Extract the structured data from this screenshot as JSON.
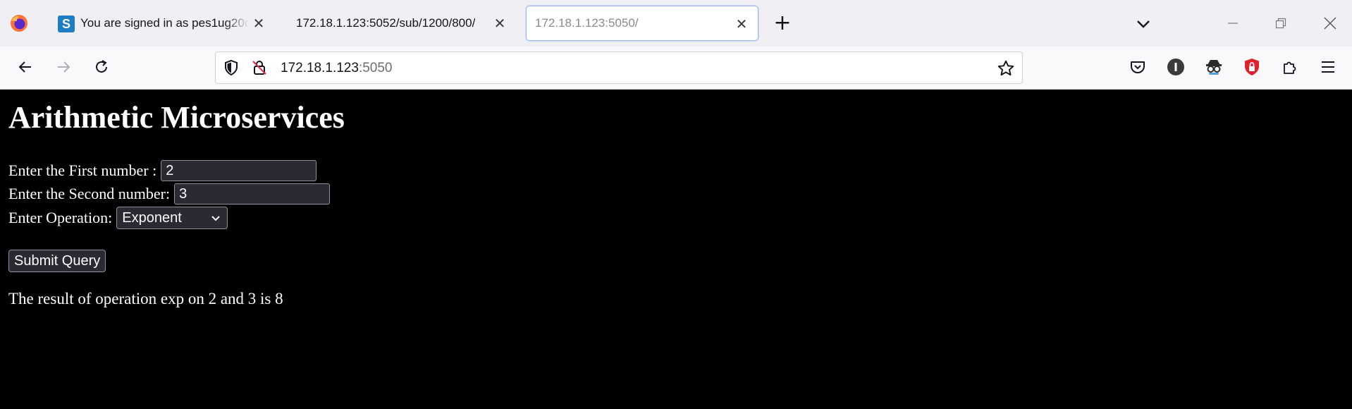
{
  "browser": {
    "tabs": [
      {
        "title": "You are signed in as pes1ug20cs",
        "favicon": "S",
        "active": false
      },
      {
        "title": "172.18.1.123:5052/sub/1200/800/",
        "active": false
      },
      {
        "title": "172.18.1.123:5050/",
        "active": true
      }
    ],
    "url_host": "172.18.1.123",
    "url_port": ":5050",
    "icons": [
      "firefox-icon",
      "new-tab-icon",
      "list-all-tabs-icon",
      "minimize-icon",
      "restore-icon",
      "close-window-icon",
      "back-icon",
      "forward-icon",
      "reload-icon",
      "shield-icon",
      "insecure-lock-icon",
      "bookmark-star-icon",
      "pocket-icon",
      "extension-i-icon",
      "extension-spy-icon",
      "ublock-icon",
      "extensions-puzzle-icon",
      "menu-icon"
    ]
  },
  "page": {
    "heading": "Arithmetic Microservices",
    "first_label": "Enter the First number :",
    "first_value": "2",
    "second_label": "Enter the Second number:",
    "second_value": "3",
    "operation_label": "Enter Operation:",
    "operation_value": "Exponent",
    "submit_label": "Submit Query",
    "result_text": "The result of operation exp on 2 and 3 is 8"
  },
  "colors": {
    "page_bg": "#000000",
    "control_bg": "#2b2a33",
    "tabstrip_bg": "#f0f0f4",
    "ublock_red": "#e0202d"
  }
}
